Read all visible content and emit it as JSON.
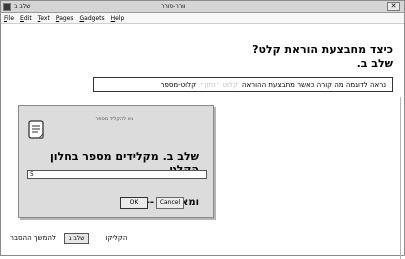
{
  "window": {
    "title_left": "שלב ב",
    "title_center": "וורר-פורר",
    "close_label": "✕"
  },
  "menu": [
    "File",
    "Edit",
    "Text",
    "Pages",
    "Gadgets",
    "Help"
  ],
  "heading": {
    "line1": "כיצד מחבצעת הוראת קלט?",
    "line2": "שלב ב."
  },
  "instruction": {
    "main": "נראה לדוגמה מה קורה כאשר מתבצעת ההוראה",
    "faded": "קלוט ״נתון״",
    "end": "קלוט-מספר"
  },
  "dialog": {
    "prompt": "נא להקליד מספר",
    "title": "שלב ב. מקלידים מספר בחלון הקלט",
    "input_value": "5",
    "action_label": "ומאשרים -->",
    "ok_label": "OK",
    "cancel_label": "Cancel"
  },
  "bottom": {
    "continue_label": "להמשך ההסבר",
    "next_button": "שלב ג",
    "click_label": "הקליקו"
  },
  "icons": {
    "app": "app-icon",
    "note": "note-icon",
    "close": "close-icon"
  }
}
